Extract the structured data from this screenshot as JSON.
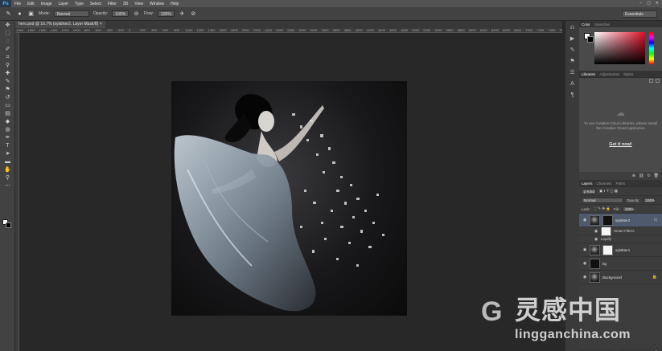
{
  "menubar": {
    "logo": "Ps",
    "items": [
      "File",
      "Edit",
      "Image",
      "Layer",
      "Type",
      "Select",
      "Filter",
      "3D",
      "View",
      "Window",
      "Help"
    ],
    "window_controls": [
      "–",
      "▢",
      "✕"
    ]
  },
  "options": {
    "mode_label": "Mode:",
    "mode_value": "Normal",
    "opacity_label": "Opacity:",
    "opacity_value": "100%",
    "flow_label": "Flow:",
    "flow_value": "100%",
    "workspace": "Essentials"
  },
  "document": {
    "tab_title": "hero.psd @ 16.7% (sylahter2, Layer Mask/8)",
    "tab_close": "×"
  },
  "ruler_ticks": [
    "-2000",
    "-1800",
    "-1600",
    "-1400",
    "-1200",
    "-1000",
    "-800",
    "-600",
    "-400",
    "-200",
    "0",
    "200",
    "400",
    "600",
    "800",
    "1000",
    "1200",
    "1400",
    "1600",
    "1800",
    "2000",
    "2200",
    "2400",
    "2600",
    "2800",
    "3000",
    "3200",
    "3400",
    "3600",
    "3800",
    "4000",
    "4200",
    "4400",
    "4600",
    "4800",
    "5000",
    "5200",
    "5400",
    "5600",
    "5800",
    "6000",
    "6200",
    "6400",
    "6600",
    "6800",
    "7000",
    "7200",
    "7400",
    "7600"
  ],
  "panels": {
    "color_tabs": {
      "active": "Color",
      "inactive": "Swatches"
    },
    "library_tabs": {
      "active": "Libraries",
      "tab2": "Adjustments",
      "tab3": "Styles"
    },
    "library_message": "To use Creative Cloud Libraries, please install the Creative Cloud Application",
    "library_link": "Get it now!",
    "layers_tabs": {
      "active": "Layers",
      "tab2": "Channels",
      "tab3": "Paths"
    },
    "kind_filter": "ρ Kind",
    "blend_mode": "Normal",
    "opacity_label": "Opacity:",
    "opacity_value": "100%",
    "lock_label": "Lock:",
    "fill_label": "Fill:",
    "fill_value": "100%",
    "layers": [
      {
        "name": "sylahter2"
      },
      {
        "name": "Smart Filters"
      },
      {
        "name": "Liquify"
      },
      {
        "name": "sylahter1"
      },
      {
        "name": "bg"
      },
      {
        "name": "Background"
      }
    ]
  },
  "watermark": {
    "logo_glyph": "G",
    "chinese": "灵感中国",
    "english": "lingganchina.com"
  },
  "colors": {
    "foreground": "#ffffff",
    "background": "#000000",
    "selected_layer": "#505a6e",
    "accent_picker": "#e0102a"
  }
}
